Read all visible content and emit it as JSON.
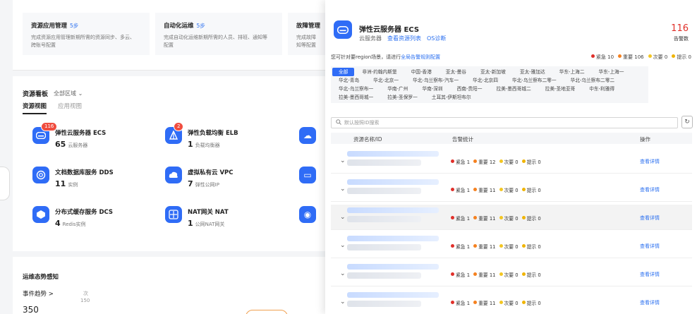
{
  "background": {
    "mgmt_cards": [
      {
        "title": "资源应用管理",
        "badge": "5步",
        "desc": "完成资源应用管理新期所需的资源同步、多云、\n跨账号配置"
      },
      {
        "title": "自动化运维",
        "badge": "5步",
        "desc": "完成自动化运维新期所需的人员、排班、通知等\n配置"
      },
      {
        "title": "故障管理",
        "badge": "",
        "desc": "完成故障\n知等配置"
      }
    ],
    "board": {
      "title": "资源看板",
      "filter": "全部区域",
      "tabs": [
        "资源视图",
        "应用视图"
      ]
    },
    "services": [
      {
        "name": "弹性云服务器 ECS",
        "count": "65",
        "unit": "云服务器",
        "badge": "116",
        "icon": "ecs-icon"
      },
      {
        "name": "弹性负载均衡 ELB",
        "count": "1",
        "unit": "负载均衡器",
        "badge": "2",
        "icon": "elb-icon"
      },
      {
        "name": "文档数据库服务 DDS",
        "count": "11",
        "unit": "实例",
        "badge": "",
        "icon": "dds-icon"
      },
      {
        "name": "虚拟私有云 VPC",
        "count": "7",
        "unit": "弹性公网IP",
        "badge": "",
        "icon": "vpc-icon"
      },
      {
        "name": "分布式缓存服务 DCS",
        "count": "4",
        "unit": "Redis实例",
        "badge": "",
        "icon": "dcs-icon"
      },
      {
        "name": "NAT网关 NAT",
        "count": "1",
        "unit": "公网NAT网关",
        "badge": "",
        "icon": "nat-icon"
      }
    ],
    "trend": {
      "title": "运维态势感知",
      "link": "事件趋势 >",
      "number": "350",
      "axis_unit": "次",
      "axis_tick": "150"
    }
  },
  "drawer": {
    "title": "弹性云服务器 ECS",
    "subtitle": "云服务器",
    "link_resources": "查看资源列表",
    "link_os": "OS诊断",
    "alarm_count": "116",
    "alarm_label": "告警数",
    "hint": "您可针对要region场景，请进行",
    "hint_link": "全局告警规则配置",
    "legend": [
      {
        "label": "紧急 10",
        "color": "#e0302a"
      },
      {
        "label": "重要 106",
        "color": "#f5811f"
      },
      {
        "label": "次要 0",
        "color": "#f3c623"
      },
      {
        "label": "提示 0",
        "color": "#f0b400"
      }
    ],
    "regions": [
      "全部",
      "非洲-约翰内斯堡",
      "中国-香港",
      "亚太-曼谷",
      "亚太-新加坡",
      "亚太-雅加达",
      "华东-上海二",
      "华东-上海一",
      "华北-青岛",
      "华北-北京一",
      "华北-乌兰察布-汽车一",
      "华北-北京四",
      "华北-乌兰察布二零一",
      "华北-乌兰察布二零二",
      "华北-乌兰察布一",
      "华南-广州",
      "华南-深圳",
      "西南-贵阳一",
      "拉美-墨西哥城二",
      "拉美-圣地亚哥",
      "中东-利雅得",
      "拉美-墨西哥城一",
      "拉美-圣保罗一",
      "土耳其-伊斯坦布尔"
    ],
    "search_placeholder": "默认按照ID搜索",
    "columns": [
      "资源名称/ID",
      "告警统计",
      "操作"
    ],
    "rows": [
      {
        "stats": [
          "紧急 1",
          "重要 12",
          "次要 0",
          "提示 0"
        ],
        "action": "查看详情"
      },
      {
        "stats": [
          "紧急 1",
          "重要 11",
          "次要 0",
          "提示 0"
        ],
        "action": "查看详情"
      },
      {
        "stats": [
          "紧急 1",
          "重要 11",
          "次要 0",
          "提示 0"
        ],
        "action": "查看详情"
      },
      {
        "stats": [
          "紧急 1",
          "重要 11",
          "次要 0",
          "提示 0"
        ],
        "action": "查看详情"
      },
      {
        "stats": [
          "紧急 1",
          "重要 11",
          "次要 0",
          "提示 0"
        ],
        "action": "查看详情"
      },
      {
        "stats": [
          "紧急 1",
          "重要 11",
          "次要 0",
          "提示 0"
        ],
        "action": "查看详情"
      }
    ]
  }
}
